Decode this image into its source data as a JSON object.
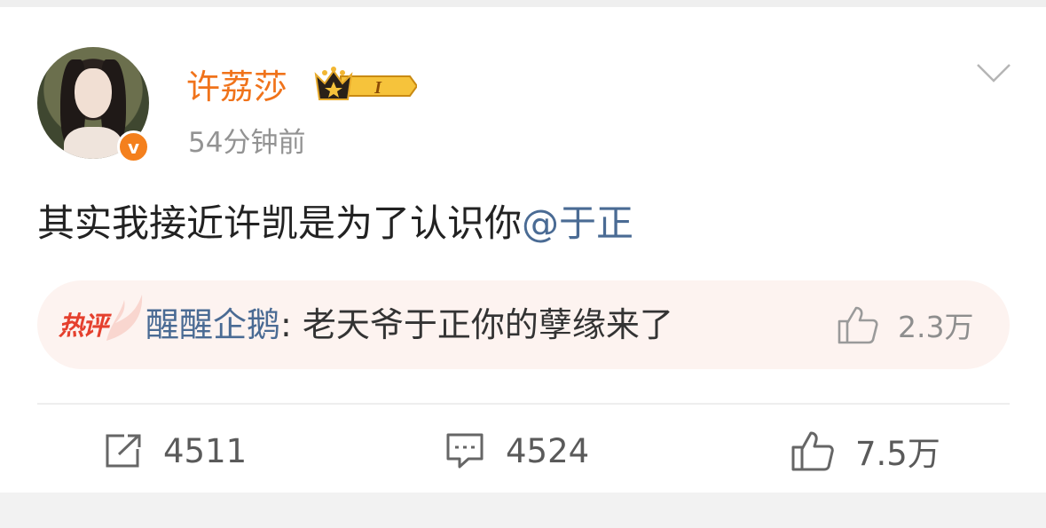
{
  "post": {
    "author": "许荔莎",
    "vip_level": "I",
    "timestamp": "54分钟前",
    "text": "其实我接近许凯是为了认识你",
    "mention": "@于正"
  },
  "hot_comment": {
    "tag": "热评",
    "commenter": "醒醒企鹅",
    "separator": ": ",
    "text": "老天爷于正你的孽缘来了",
    "likes": "2.3万"
  },
  "actions": {
    "reposts": "4511",
    "comments": "4524",
    "likes": "7.5万"
  },
  "colors": {
    "username": "#f0731b",
    "link": "#4a6b94",
    "verify_badge": "#f4801d",
    "hot_tag": "#e5402e",
    "hot_comment_bg": "#fdf3f0"
  },
  "icons": {
    "verify": "verified-v-icon",
    "vip": "crown-vip-icon",
    "menu": "chevron-down-icon",
    "repost": "share-icon",
    "comment": "comment-icon",
    "like": "thumbs-up-icon"
  }
}
